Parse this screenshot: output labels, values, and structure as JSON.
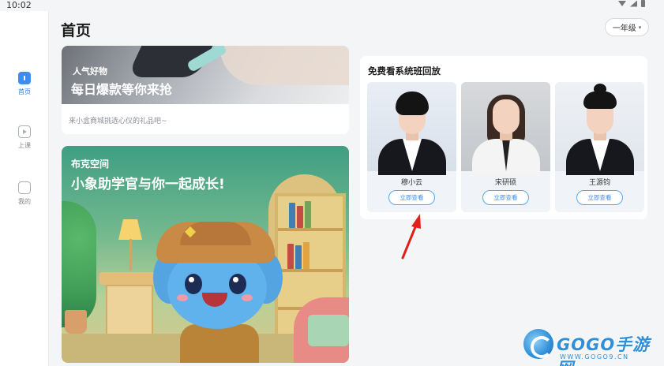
{
  "status_bar": {
    "time": "10:02"
  },
  "sidebar": {
    "items": [
      {
        "label": "首页",
        "icon": "home-icon",
        "active": true
      },
      {
        "label": "上课",
        "icon": "play-class-icon",
        "active": false
      },
      {
        "label": "我的",
        "icon": "profile-icon",
        "active": false
      }
    ]
  },
  "header": {
    "title": "首页",
    "grade_select": {
      "value": "一年级"
    }
  },
  "banner_shop": {
    "kicker": "人气好物",
    "headline": "每日爆款等你来抢",
    "caption": "来小盒商城挑选心仪的礼品吧~"
  },
  "banner_space": {
    "kicker": "布克空间",
    "headline": "小象助学官与你一起成长!"
  },
  "replay": {
    "title": "免费看系统班回放",
    "teachers": [
      {
        "name": "穆小云",
        "button": "立即查看"
      },
      {
        "name": "宋研硕",
        "button": "立即查看"
      },
      {
        "name": "王源钧",
        "button": "立即查看"
      }
    ]
  },
  "watermark": {
    "brand": "GOGO手游网",
    "url": "WWW.GOGO9.CN"
  },
  "colors": {
    "accent": "#2d7ff2",
    "arrow": "#e0201a"
  }
}
